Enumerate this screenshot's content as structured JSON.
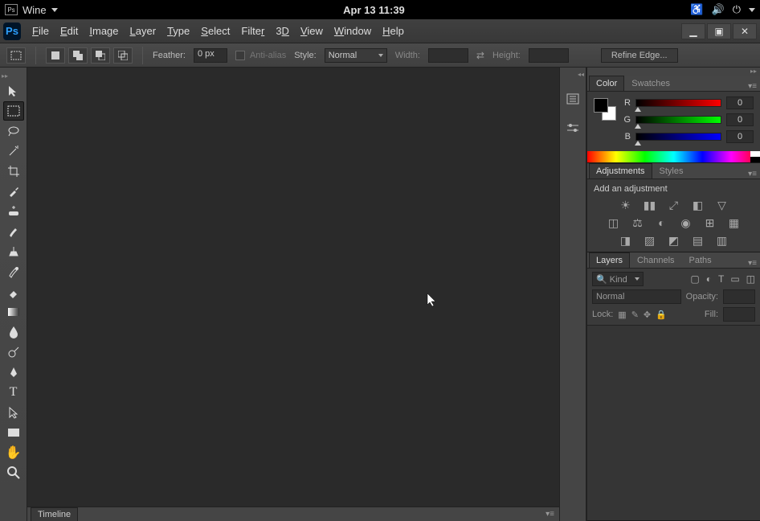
{
  "os": {
    "app_menu_label": "Wine",
    "clock": "Apr 13  11:39"
  },
  "menus": {
    "file": "File",
    "edit": "Edit",
    "image": "Image",
    "layer": "Layer",
    "type": "Type",
    "select": "Select",
    "filter": "Filter",
    "threeD": "3D",
    "view": "View",
    "window": "Window",
    "help": "Help"
  },
  "options": {
    "feather_label": "Feather:",
    "feather_value": "0 px",
    "antialias_label": "Anti-alias",
    "style_label": "Style:",
    "style_value": "Normal",
    "width_label": "Width:",
    "height_label": "Height:",
    "refine_label": "Refine Edge..."
  },
  "timeline": {
    "tab": "Timeline"
  },
  "panels": {
    "color": {
      "tab_color": "Color",
      "tab_swatches": "Swatches",
      "r_label": "R",
      "g_label": "G",
      "b_label": "B",
      "r": "0",
      "g": "0",
      "b": "0"
    },
    "adjustments": {
      "tab_adjustments": "Adjustments",
      "tab_styles": "Styles",
      "hint": "Add an adjustment"
    },
    "layers": {
      "tab_layers": "Layers",
      "tab_channels": "Channels",
      "tab_paths": "Paths",
      "kind_label": "Kind",
      "blend_value": "Normal",
      "opacity_label": "Opacity:",
      "lock_label": "Lock:",
      "fill_label": "Fill:"
    }
  }
}
